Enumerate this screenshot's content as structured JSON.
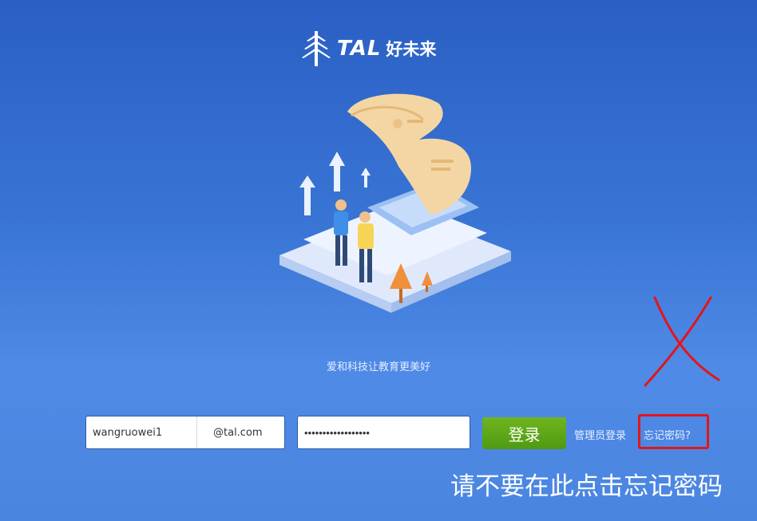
{
  "logo": {
    "brand_en": "TAL",
    "brand_cn": "好未来",
    "icon": "pine-tree-icon"
  },
  "slogan": "爱和科技让教育更美好",
  "login_form": {
    "username_value": "wangruowei1",
    "domain_suffix": "@tal.com",
    "password_value": "••••••••••••••••••",
    "login_button": "登录",
    "admin_login_link": "管理员登录",
    "forgot_password_link": "忘记密码?"
  },
  "annotation": {
    "note_text": "请不要在此点击忘记密码",
    "mark_color": "#e3151b"
  },
  "colors": {
    "accent_green": "#5aa515",
    "background_blue": "#3a76d6"
  }
}
